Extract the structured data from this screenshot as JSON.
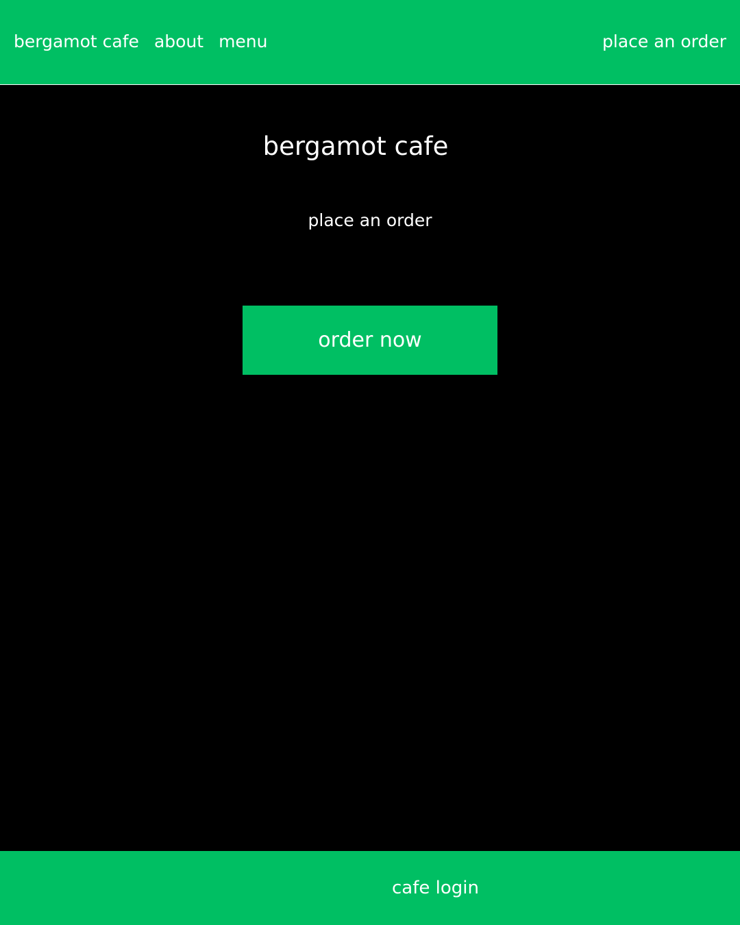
{
  "colors": {
    "brand_green": "#00bf63",
    "background": "#000000",
    "text": "#ffffff"
  },
  "header": {
    "nav": [
      {
        "label": "bergamot cafe"
      },
      {
        "label": "about"
      },
      {
        "label": "menu"
      }
    ],
    "cta_label": "place an order"
  },
  "hero": {
    "title": "bergamot cafe",
    "subtitle": "place an order",
    "button_label": "order now"
  },
  "footer": {
    "link_label": "cafe login"
  }
}
